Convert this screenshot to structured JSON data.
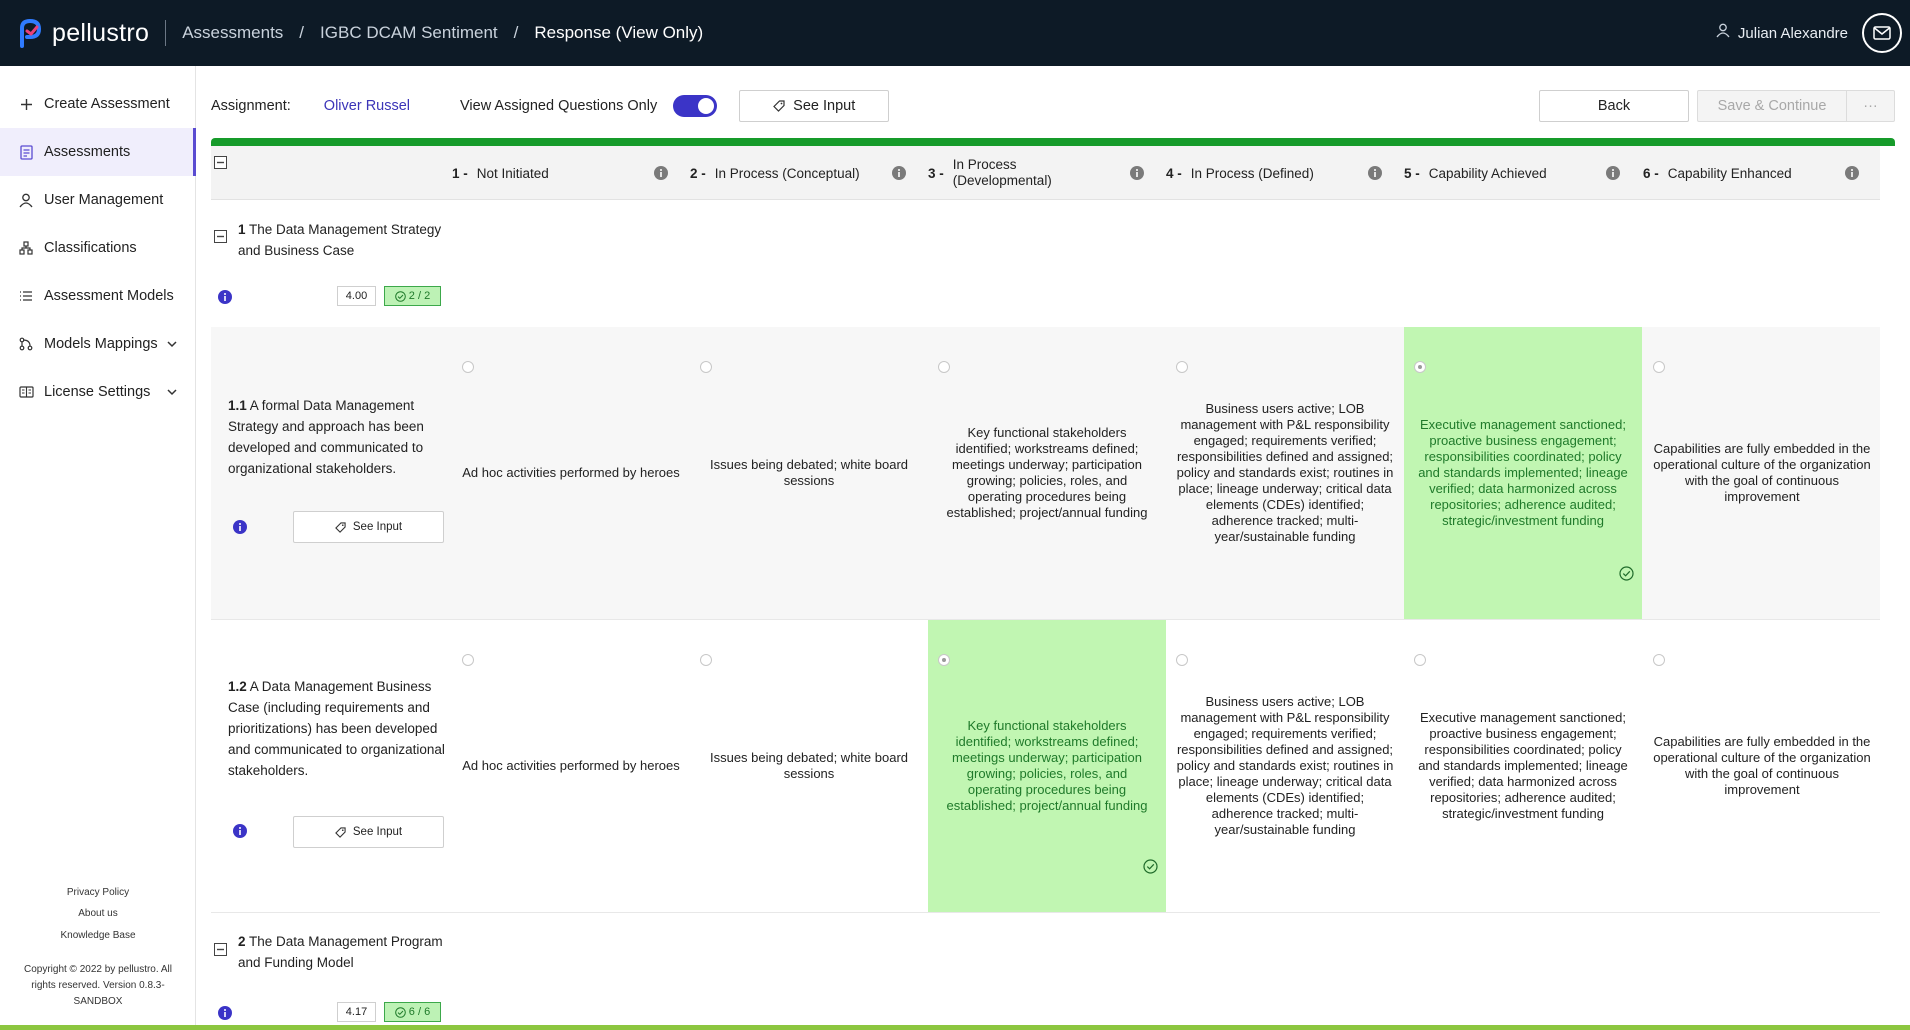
{
  "header": {
    "brand": "pellustro",
    "breadcrumbs": [
      "Assessments",
      "IGBC DCAM Sentiment",
      "Response (View Only)"
    ],
    "user_name": "Julian Alexandre"
  },
  "sidebar": {
    "items": [
      {
        "label": "Create Assessment",
        "icon": "plus-icon"
      },
      {
        "label": "Assessments",
        "icon": "clipboard-icon"
      },
      {
        "label": "User Management",
        "icon": "user-icon"
      },
      {
        "label": "Classifications",
        "icon": "hierarchy-icon"
      },
      {
        "label": "Assessment Models",
        "icon": "list-icon"
      },
      {
        "label": "Models Mappings",
        "icon": "mapping-icon"
      },
      {
        "label": "License Settings",
        "icon": "license-icon"
      }
    ],
    "footer": {
      "privacy": "Privacy Policy",
      "about": "About us",
      "kb": "Knowledge Base",
      "copyright": "Copyright © 2022 by pellustro. All rights reserved. Version 0.8.3-SANDBOX"
    }
  },
  "toolbar": {
    "assignment_label": "Assignment:",
    "assignee": "Oliver Russel",
    "toggle_label": "View Assigned Questions Only",
    "toggle_on": true,
    "see_input": "See Input",
    "back": "Back",
    "save": "Save & Continue",
    "more": "···"
  },
  "levels": [
    {
      "num": "1 -",
      "label": "Not Initiated"
    },
    {
      "num": "2 -",
      "label": "In Process (Conceptual)"
    },
    {
      "num": "3 -",
      "label": "In Process (Developmental)"
    },
    {
      "num": "4 -",
      "label": "In Process (Defined)"
    },
    {
      "num": "5 -",
      "label": "Capability Achieved"
    },
    {
      "num": "6 -",
      "label": "Capability Enhanced"
    }
  ],
  "sections": [
    {
      "num": "1",
      "title": "The Data Management Strategy and Business Case",
      "score": "4.00",
      "count": "2 / 2"
    },
    {
      "num": "2",
      "title": "The Data Management Program and Funding Model",
      "score": "4.17",
      "count": "6 / 6"
    }
  ],
  "questions": [
    {
      "num": "1.1",
      "text": "A formal Data Management Strategy and approach has been developed and communicated to organizational stakeholders.",
      "see_input": "See Input",
      "selected_level": 5,
      "cells": [
        "Ad hoc activities performed by heroes",
        "Issues being debated; white board sessions",
        "Key functional stakeholders identified; workstreams defined; meetings underway; participation growing; policies, roles, and operating procedures being established; project/annual funding",
        "Business users active; LOB management with P&L responsibility engaged; requirements verified; responsibilities defined and assigned; policy and standards exist; routines in place; lineage underway; critical data elements (CDEs) identified; adherence tracked; multi-year/sustainable funding",
        "Executive management sanctioned; proactive business engagement; responsibilities coordinated; policy and standards implemented; lineage verified; data harmonized across repositories; adherence audited; strategic/investment funding",
        "Capabilities are fully embedded in the operational culture of the organization with the goal of continuous improvement"
      ]
    },
    {
      "num": "1.2",
      "text": "A Data Management Business Case (including requirements and prioritizations) has been developed and communicated to organizational stakeholders.",
      "see_input": "See Input",
      "selected_level": 3,
      "cells": [
        "Ad hoc activities performed by heroes",
        "Issues being debated; white board sessions",
        "Key functional stakeholders identified; workstreams defined; meetings underway; participation growing; policies, roles, and operating procedures being established; project/annual funding",
        "Business users active; LOB management with P&L responsibility engaged; requirements verified; responsibilities defined and assigned; policy and standards exist; routines in place; lineage underway; critical data elements (CDEs) identified; adherence tracked; multi-year/sustainable funding",
        "Executive management sanctioned; proactive business engagement; responsibilities coordinated; policy and standards implemented; lineage verified; data harmonized across repositories; adherence audited; strategic/investment funding",
        "Capabilities are fully embedded in the operational culture of the organization with the goal of continuous improvement"
      ]
    }
  ],
  "colors": {
    "topbar": "#0d1a26",
    "accent": "#3b34c7",
    "progress": "#169b2a",
    "selected_cell": "#c1f6b2",
    "bottom_line": "#8cc63f"
  }
}
